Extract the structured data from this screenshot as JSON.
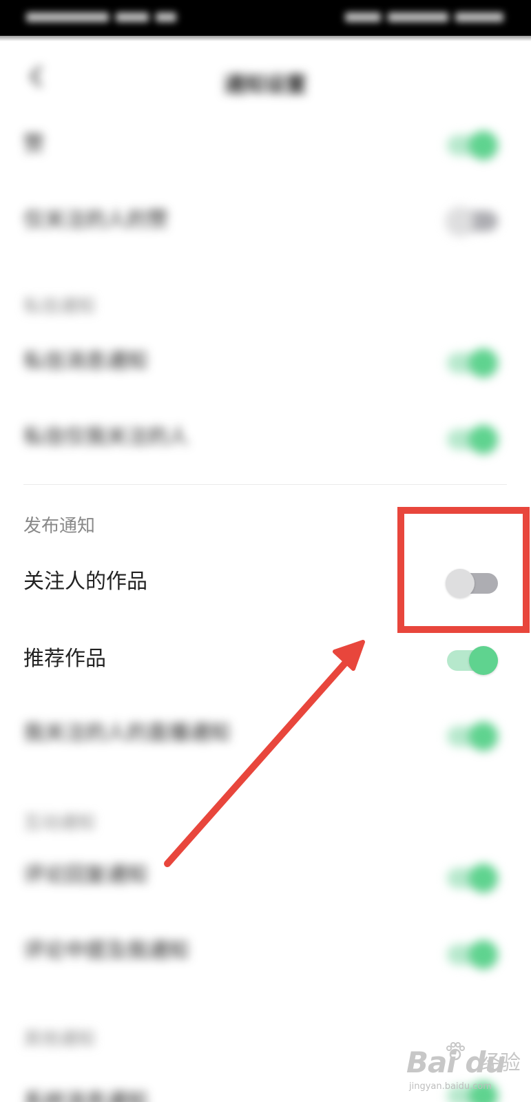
{
  "status_bar": {},
  "header": {
    "title": "通知设置",
    "back_icon": "back-arrow-icon"
  },
  "settings": [
    {
      "label": "赞",
      "toggle": "on",
      "blurred": true
    },
    {
      "label": "仅关注的人的赞",
      "toggle": "off",
      "blurred": true
    },
    {
      "section": "私信通知",
      "blurred": true
    },
    {
      "label": "私信消息通知",
      "toggle": "on",
      "blurred": true
    },
    {
      "label": "私信仅我关注的人",
      "toggle": "on",
      "blurred": true
    },
    {
      "section": "发布通知",
      "blurred": false
    },
    {
      "label": "关注人的作品",
      "toggle": "off",
      "blurred": false
    },
    {
      "label": "推荐作品",
      "toggle": "on",
      "blurred": false
    },
    {
      "label": "我关注的人的直播通知",
      "toggle": "on",
      "blurred": true
    },
    {
      "section": "互动通知",
      "blurred": true
    },
    {
      "label": "评论回复通知",
      "toggle": "on",
      "blurred": true
    },
    {
      "label": "评论中提及我通知",
      "toggle": "on",
      "blurred": true
    },
    {
      "section": "其他通知",
      "blurred": true
    },
    {
      "label": "系统消息通知",
      "toggle": "on",
      "blurred": true
    }
  ],
  "visible_section": {
    "title": "发布通知"
  },
  "visible_items": [
    {
      "label": "关注人的作品",
      "toggle": "off"
    },
    {
      "label": "推荐作品",
      "toggle": "on"
    }
  ],
  "colors": {
    "toggle_on": "#5fd38f",
    "toggle_on_track": "#b6e8cc",
    "toggle_off_track": "#adadb2",
    "annotation": "#e8463c"
  },
  "watermark": {
    "logo": "Bai du",
    "text": "经验",
    "url": "jingyan.baidu.com"
  }
}
